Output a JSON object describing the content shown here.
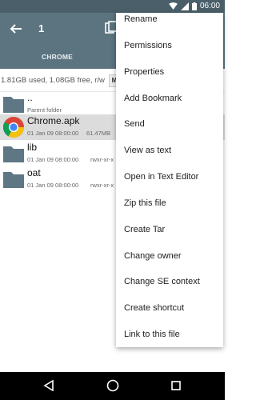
{
  "status": {
    "time": "06:00"
  },
  "appbar": {
    "title": "1"
  },
  "tabs": [
    {
      "label": "CHROME"
    }
  ],
  "storage": {
    "text": "1.81GB used, 1.08GB free, r/w",
    "chip": "M"
  },
  "files": [
    {
      "name": "..",
      "sub": "Parent folder",
      "perm": "",
      "icon": "folder-icon",
      "size": ""
    },
    {
      "name": "Chrome.apk",
      "sub": "01 Jan 09 08:00:00",
      "size": "61.47MB",
      "perm": "",
      "icon": "chrome-icon"
    },
    {
      "name": "lib",
      "sub": "01 Jan 09 08:00:00",
      "size": "",
      "perm": "rwxr-xr-x",
      "icon": "folder-icon"
    },
    {
      "name": "oat",
      "sub": "01 Jan 09 08:00:00",
      "size": "",
      "perm": "rwxr-xr-x",
      "icon": "folder-icon"
    }
  ],
  "menu": {
    "items": [
      "Rename",
      "Permissions",
      "Properties",
      "Add Bookmark",
      "Send",
      "View as text",
      "Open in Text Editor",
      "Zip this file",
      "Create Tar",
      "Change owner",
      "Change SE context",
      "Create shortcut",
      "Link to this file"
    ]
  },
  "colors": {
    "appbar": "#5b7480",
    "statusbar": "#4a5f6a",
    "folder": "#5f7784",
    "selected_row": "#dcdcdc"
  }
}
